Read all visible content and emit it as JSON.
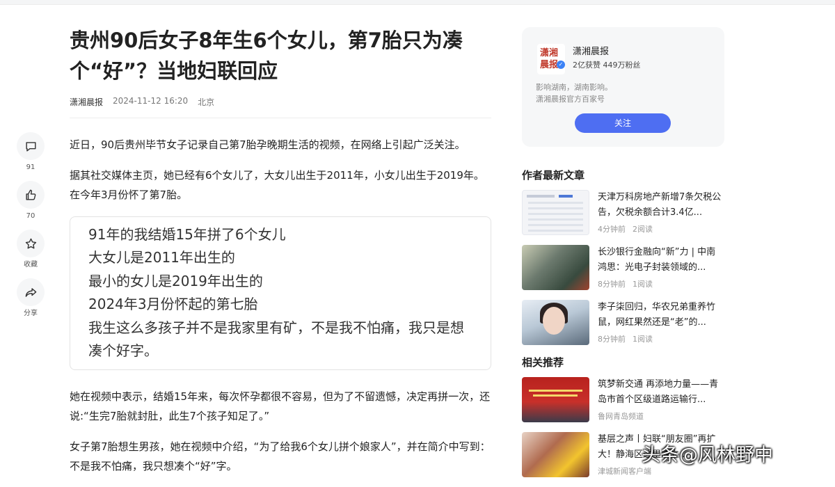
{
  "article": {
    "title": "贵州90后女子8年生6个女儿，第7胎只为凑个“好”？当地妇联回应",
    "author": "潇湘晨报",
    "date": "2024-11-12 16:20",
    "location": "北京",
    "paragraphs": [
      "近日，90后贵州毕节女子记录自己第7胎孕晚期生活的视频，在网络上引起广泛关注。",
      "据其社交媒体主页，她已经有6个女儿了，大女儿出生于2011年，小女儿出生于2019年。在今年3月份怀了第7胎。",
      "她在视频中表示，结婚15年来，每次怀孕都很不容易，但为了不留遗憾，决定再拼一次，还说:“生完7胎就封肚，此生7个孩子知足了。”",
      "女子第7胎想生男孩，她在视频中介绍，“为了给我6个女儿拼个娘家人”，并在简介中写到：不是我不怕痛，我只想凑个“好”字。"
    ],
    "quote_lines": [
      "91年的我结婚15年拼了6个女儿",
      "大女儿是2011年出生的",
      "最小的女儿是2019年出生的",
      "2024年3月份怀起的第七胎",
      "我生这么多孩子并不是我家里有矿，不是我不怕痛，我只是想凑个好字。"
    ]
  },
  "actions": {
    "comment": {
      "icon": "comment-icon",
      "count": "91"
    },
    "like": {
      "icon": "thumbs-up-icon",
      "count": "70"
    },
    "favorite": {
      "icon": "star-icon",
      "label": "收藏"
    },
    "share": {
      "icon": "share-icon",
      "label": "分享"
    }
  },
  "author_card": {
    "logo_text": "潇湘晨报",
    "name": "潇湘晨报",
    "stats": "2亿获赞 449万粉丝",
    "description": "影响湖南，湖南影响。",
    "subtitle": "潇湘晨报官方百家号",
    "follow_label": "关注"
  },
  "latest": {
    "heading": "作者最新文章",
    "items": [
      {
        "title": "天津万科房地产新增7条欠税公告，欠税余额合计3.4亿...",
        "time": "4分钟前",
        "reads": "2阅读"
      },
      {
        "title": "长沙银行金融向“新”力 | 中南鸿思：光电子封装领域的...",
        "time": "8分钟前",
        "reads": "1阅读"
      },
      {
        "title": "李子柒回归，华农兄弟重养竹鼠，网红果然还是“老”的...",
        "time": "8分钟前",
        "reads": "1阅读"
      }
    ]
  },
  "related": {
    "heading": "相关推荐",
    "items": [
      {
        "title": "筑梦新交通 再添地力量——青岛市首个区级道路运输行...",
        "source": "鲁网青岛频道"
      },
      {
        "title": "基层之声丨妇联“朋友圈”再扩大！静海区这里成立...",
        "source": "津城新闻客户端"
      }
    ]
  },
  "watermark": "头条@风林野中",
  "colors": {
    "accent": "#4e6ef2",
    "text": "#222222",
    "muted": "#999999"
  }
}
